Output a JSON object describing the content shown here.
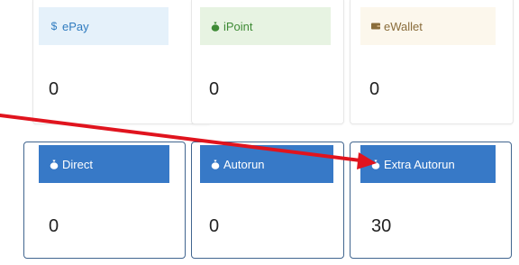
{
  "cards": {
    "epay": {
      "label": "ePay",
      "icon": "dollar-icon",
      "value": "0"
    },
    "ipoint": {
      "label": "iPoint",
      "icon": "money-bag-icon",
      "value": "0"
    },
    "ewallet": {
      "label": "eWallet",
      "icon": "wallet-icon",
      "value": "0"
    },
    "direct": {
      "label": "Direct",
      "icon": "money-bag-icon",
      "value": "0"
    },
    "autorun": {
      "label": "Autorun",
      "icon": "money-bag-icon",
      "value": "0"
    },
    "extra_autorun": {
      "label": "Extra Autorun",
      "icon": "money-bag-icon",
      "value": "30"
    }
  },
  "colors": {
    "header_blue": "#3779c7",
    "card_border": "#41658f",
    "annotation_arrow": "#e0141e"
  }
}
